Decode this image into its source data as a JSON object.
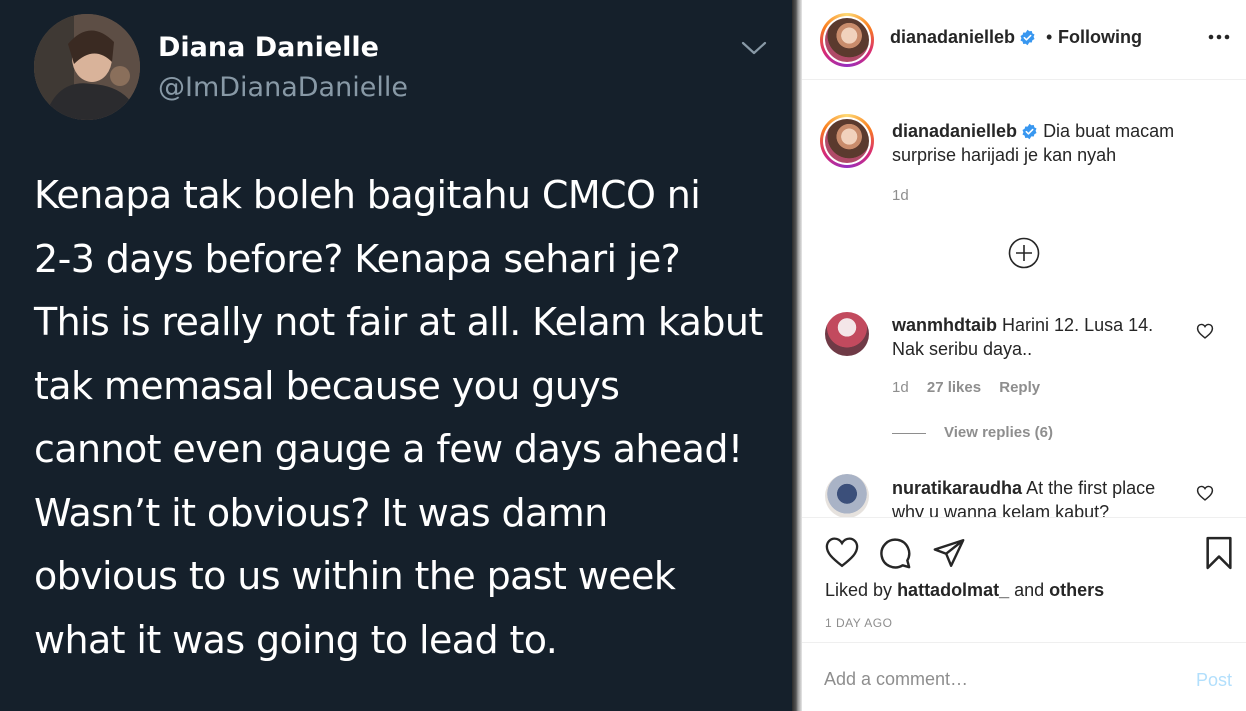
{
  "tweet": {
    "name": "Diana Danielle",
    "handle": "@ImDianaDanielle",
    "lines": [
      "Kenapa tak boleh bagitahu CMCO ni",
      "2-3 days before? Kenapa sehari je?",
      "This is really not fair at all. Kelam kabut",
      "tak memasal because you guys",
      "cannot even gauge a few days ahead!",
      "Wasn’t it obvious? It was damn",
      "obvious to us within the past week",
      "what it was going to lead to."
    ],
    "avatar_icon": "profile-photo",
    "menu_icon": "chevron-down-icon"
  },
  "post": {
    "header": {
      "username": "dianadanielleb",
      "dot": "•",
      "follow_status": "Following",
      "more_icon": "more-horizontal-icon"
    },
    "caption": {
      "username": "dianadanielleb",
      "text": "Dia buat macam surprise harijadi je kan nyah",
      "time": "1d"
    },
    "load_more_icon": "plus-circle-icon",
    "comments": [
      {
        "username": "wanmhdtaib",
        "text": "Harini 12. Lusa 14. Nak seribu daya..",
        "time": "1d",
        "likes": "27 likes",
        "reply": "Reply",
        "view_replies": "View replies (6)"
      },
      {
        "username": "nuratikaraudha",
        "text": "At the first place why u wanna kelam kabut?"
      }
    ],
    "actions": {
      "like_icon": "heart-icon",
      "comment_icon": "comment-icon",
      "share_icon": "paper-plane-icon",
      "save_icon": "bookmark-icon"
    },
    "likes": {
      "prefix": "Liked by",
      "user": "hattadolmat_",
      "and": "and",
      "others": "others"
    },
    "timestamp": "1 DAY AGO",
    "add_comment": {
      "placeholder": "Add a comment…",
      "post_label": "Post"
    }
  },
  "colors": {
    "tweet_bg": "#15202b",
    "tweet_secondary": "#8899a6",
    "verified_blue": "#3897f0",
    "post_button_disabled": "#b2dffc"
  }
}
